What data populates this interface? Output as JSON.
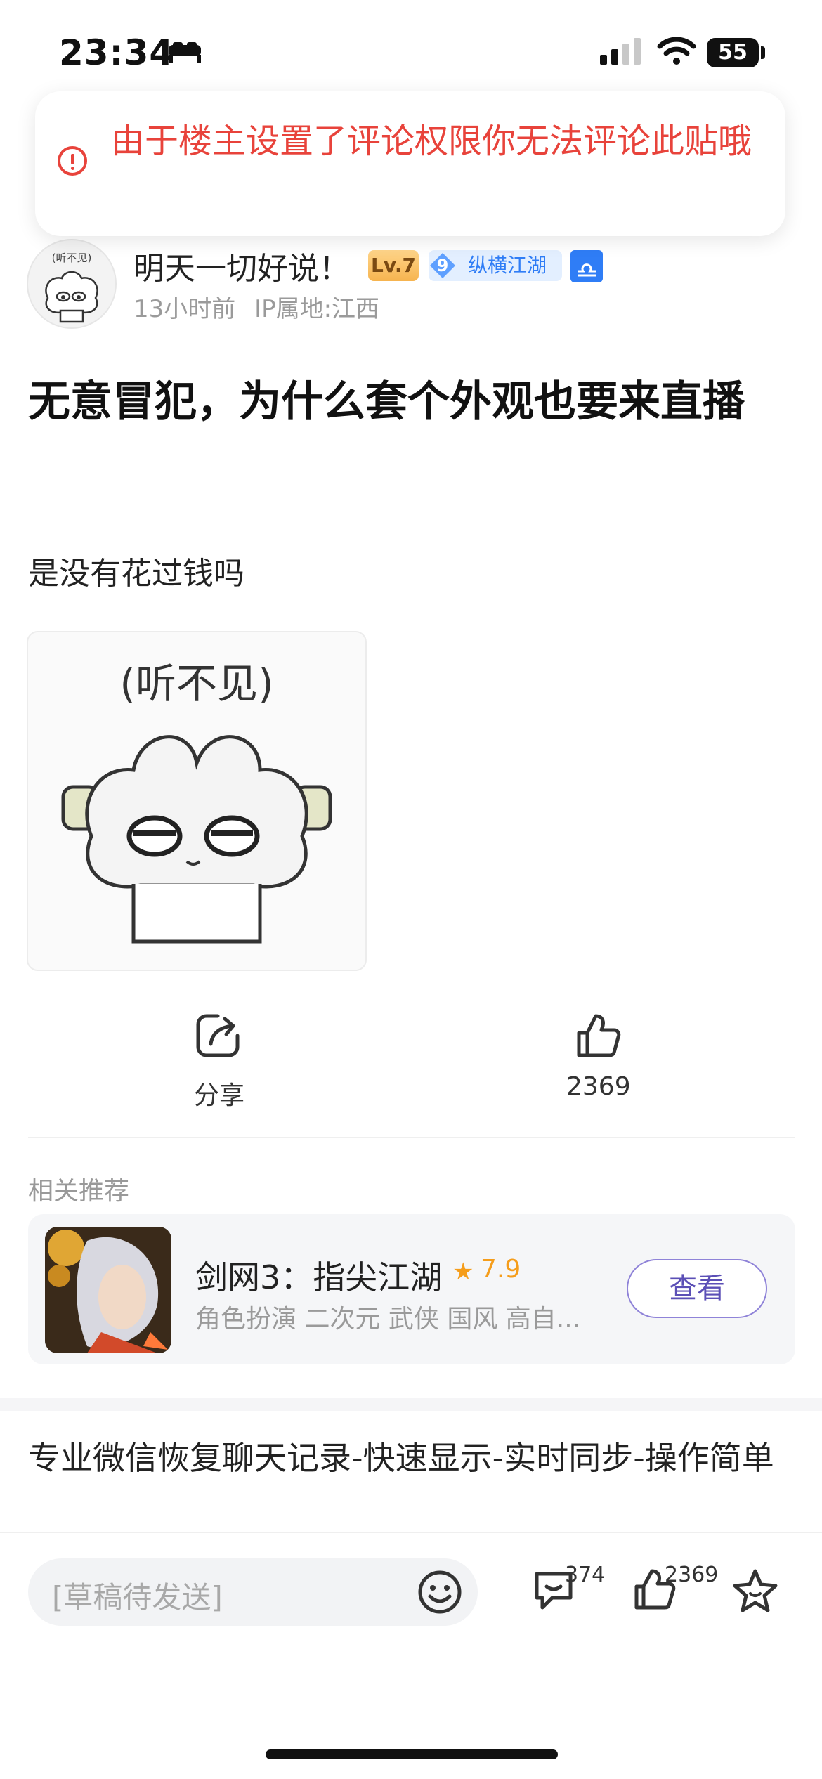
{
  "status_bar": {
    "time": "23:34",
    "battery": "55"
  },
  "toast": {
    "message": "由于楼主设置了评论权限你无法评论此贴哦"
  },
  "author": {
    "name": "明天一切好说！",
    "level": "Lv.7",
    "fan_level": "9",
    "fan_group": "纵横江湖",
    "meta": "13小时前 IP属地:江西",
    "avatar_caption": "(听不见)"
  },
  "post": {
    "title": "无意冒犯，为什么套个外观也要来直播",
    "body": "是没有花过钱吗",
    "image_caption": "(听不见)"
  },
  "actions": {
    "share_label": "分享",
    "like_count": "2369"
  },
  "recommend": {
    "section_label": "相关推荐",
    "game_name": "剑网3：指尖江湖",
    "rating": "7.9",
    "tags": "角色扮演 二次元 武侠 国风 高自...",
    "view_button": "查看"
  },
  "ad": {
    "text": "专业微信恢复聊天记录-快速显示-实时同步-操作简单"
  },
  "bottom_bar": {
    "input_placeholder": "[草稿待发送]",
    "comment_count": "374",
    "like_count": "2369"
  },
  "colors": {
    "accent_red": "#e8433b",
    "brand_blue": "#2f7df6",
    "button_purple": "#5b4fb6",
    "rating_orange": "#f59d1b"
  },
  "icons": [
    "sleep-bed-icon",
    "signal-icon",
    "wifi-icon",
    "battery-icon",
    "alert-circle-icon",
    "libra-icon",
    "share-icon",
    "thumb-up-icon",
    "star-rating-icon",
    "emoji-icon",
    "comment-icon",
    "favorite-star-icon"
  ]
}
